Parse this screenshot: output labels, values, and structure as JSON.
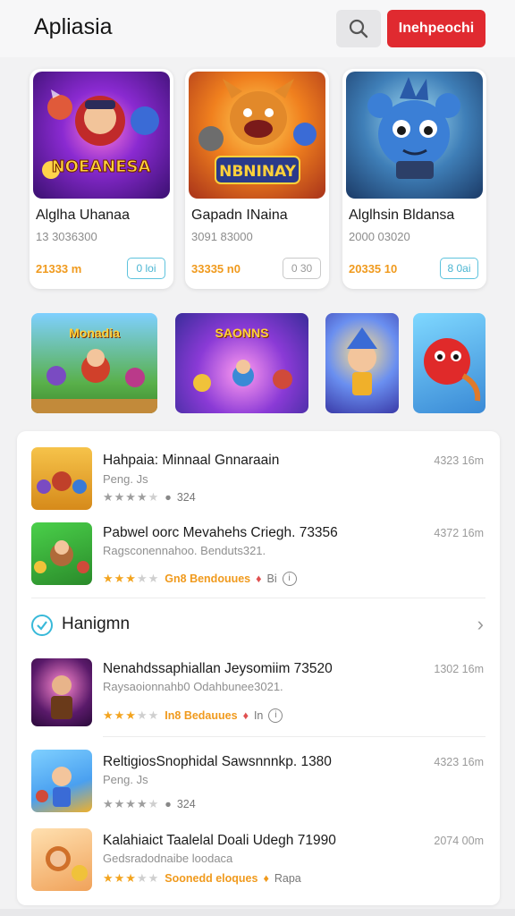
{
  "header": {
    "title": "Apliasia",
    "search_icon": "search-icon",
    "cta_label": "Inehpeochi"
  },
  "featured": [
    {
      "art_text": "NOEANESA",
      "title": "Alglha Uhanaa",
      "subtitle": "13 3036300",
      "price": "21333 m",
      "chip": "0 loi"
    },
    {
      "art_text": "NBNINAY",
      "title": "Gapadn INaina",
      "subtitle": "3091 83000",
      "price": "33335 n0",
      "chip": "0 30"
    },
    {
      "art_text": "",
      "title": "Alglhsin Bldansa",
      "subtitle": "2000 03020",
      "price": "20335 10",
      "chip": "8 0ai"
    }
  ],
  "tiles": [
    {
      "text": "Monadia"
    },
    {
      "text": "SAONNS"
    },
    {
      "text": ""
    },
    {
      "text": ""
    }
  ],
  "list_top": [
    {
      "title": "Hahpaia: Minnaal Gnnaraain",
      "subtitle": "Peng. Js",
      "time": "4323 16m",
      "meta_text": "324",
      "rating": 4
    },
    {
      "title": "Pabwel oorc Mevahehs Criegh. 73356",
      "subtitle": "Ragsconennahoo. Benduts321.",
      "time": "4372 16m",
      "meta_text": "Gn8 Bendouues",
      "meta_tail": "Bi",
      "rating": 3
    }
  ],
  "section": {
    "title": "Hanigmn",
    "check_icon": "check-circle-icon",
    "chevron_icon": "chevron-right-icon"
  },
  "list_bottom": [
    {
      "title": "Nenahdssaphiallan Jeysomiim 73520",
      "subtitle": "Raysaoionnahb0 Odahbunee3021.",
      "time": "1302 16m",
      "meta_text": "In8 Bedauues",
      "meta_tail": "In",
      "rating": 3
    },
    {
      "title": "ReltigiosSnophidal Sawsnnnkp. 1380",
      "subtitle": "Peng. Js",
      "time": "4323 16m",
      "meta_text": "324",
      "rating": 4
    },
    {
      "title": "Kalahiaict Taalelal Doali Udegh 71990",
      "subtitle": "Gedsradodnaibe loodaca",
      "time": "2074 00m",
      "meta_text": "Soonedd eloques",
      "meta_tail": "Rapa",
      "rating": 3
    }
  ]
}
